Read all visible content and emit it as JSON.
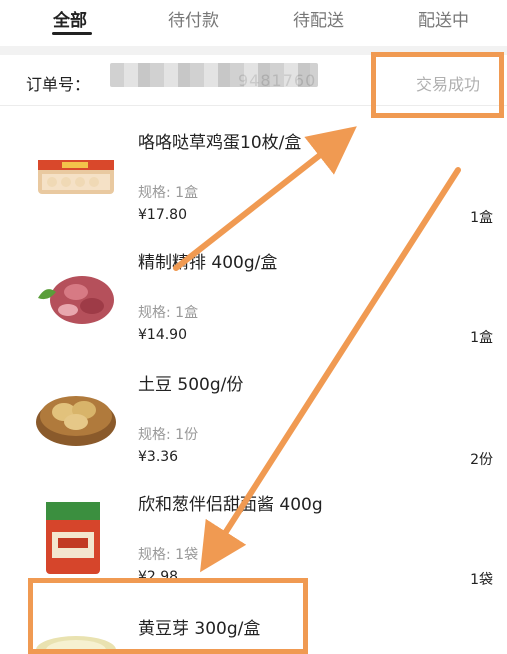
{
  "tabs": [
    {
      "label": "全部",
      "active": true
    },
    {
      "label": "待付款",
      "active": false
    },
    {
      "label": "待配送",
      "active": false
    },
    {
      "label": "配送中",
      "active": false
    }
  ],
  "order": {
    "label": "订单号：",
    "number_visible": "9481760",
    "status": "交易成功"
  },
  "items": [
    {
      "name": "咯咯哒草鸡蛋10枚/盒",
      "spec": "规格: 1盒",
      "price": "¥17.80",
      "qty": "1盒"
    },
    {
      "name": "精制精排 400g/盒",
      "spec": "规格: 1盒",
      "price": "¥14.90",
      "qty": "1盒"
    },
    {
      "name": "土豆 500g/份",
      "spec": "规格: 1份",
      "price": "¥3.36",
      "qty": "2份"
    },
    {
      "name": "欣和葱伴侣甜面酱 400g",
      "spec": "规格: 1袋",
      "price": "¥2.98",
      "qty": "1袋"
    },
    {
      "name": "黄豆芽 300g/盒",
      "spec": "",
      "price": "",
      "qty": ""
    }
  ],
  "colors": {
    "annotation": "#f09a52",
    "status": "#b0b0b0"
  }
}
